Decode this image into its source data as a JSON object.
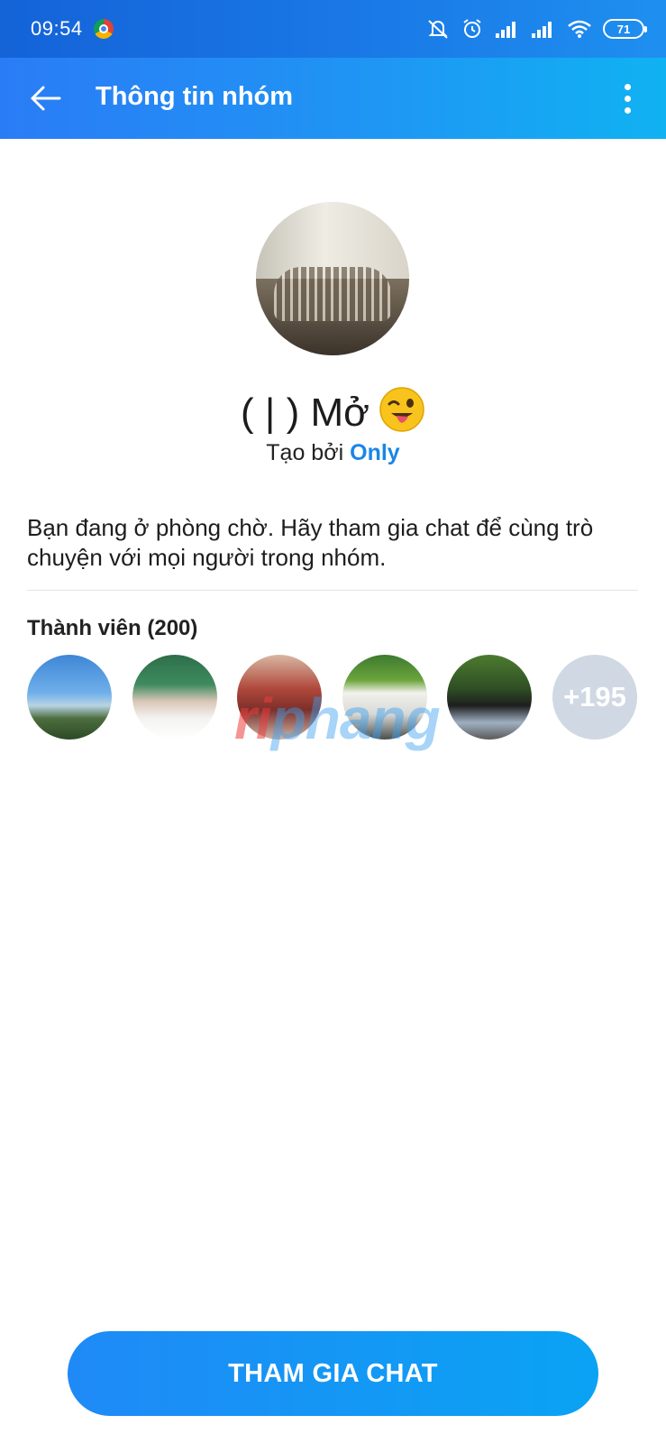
{
  "status_bar": {
    "time": "09:54",
    "battery": "71",
    "icons": [
      "chrome-icon",
      "mute-bell-icon",
      "alarm-icon",
      "signal-icon",
      "signal-icon",
      "wifi-icon",
      "battery-icon"
    ]
  },
  "app_bar": {
    "title": "Thông tin nhóm",
    "back_icon": "arrow-left-icon",
    "more_icon": "more-vertical-icon"
  },
  "group": {
    "name": "( | ) Mở",
    "name_emoji": "winking-face-with-tongue",
    "created_by_prefix": "Tạo bởi",
    "creator": "Only",
    "waiting_message": "Bạn đang ở phòng chờ. Hãy tham gia chat để cùng trò chuyện với mọi người trong nhóm."
  },
  "members": {
    "title": "Thành viên (200)",
    "visible_count": 5,
    "more_label": "+195"
  },
  "watermark": {
    "first": "ri",
    "rest": "phang"
  },
  "actions": {
    "join_label": "THAM GIA CHAT"
  },
  "colors": {
    "accent": "#1a86e8",
    "button_start": "#1f8af6",
    "button_end": "#0aa3f4",
    "more_bubble": "#cfd8e3"
  }
}
